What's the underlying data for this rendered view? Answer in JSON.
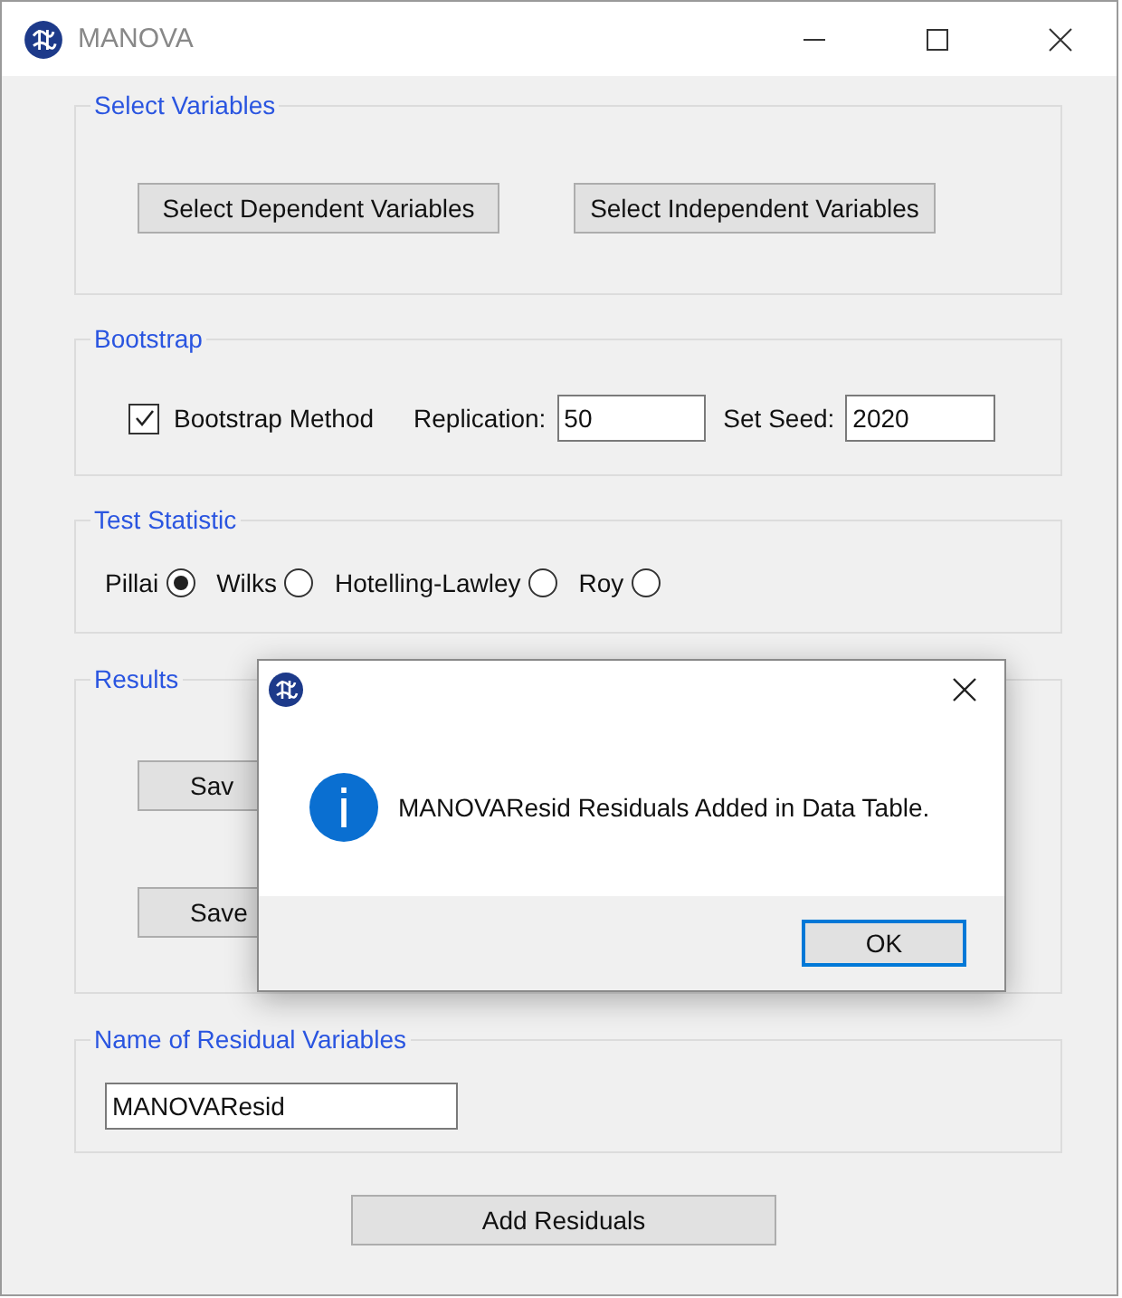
{
  "window": {
    "title": "MANOVA"
  },
  "select_variables": {
    "legend": "Select Variables",
    "buttons": [
      "Select Dependent Variables",
      "Select Independent Variables"
    ]
  },
  "bootstrap": {
    "legend": "Bootstrap",
    "checkbox": {
      "label": "Bootstrap Method",
      "checked": true
    },
    "replication": {
      "label": "Replication:",
      "value": "50"
    },
    "seed": {
      "label": "Set Seed:",
      "value": "2020"
    }
  },
  "test_statistic": {
    "legend": "Test Statistic",
    "options": [
      {
        "label": "Pillai",
        "selected": true
      },
      {
        "label": "Wilks",
        "selected": false
      },
      {
        "label": "Hotelling-Lawley",
        "selected": false
      },
      {
        "label": "Roy",
        "selected": false
      }
    ]
  },
  "results": {
    "legend": "Results",
    "buttons": [
      "Sav",
      "Save"
    ]
  },
  "residual_name": {
    "legend": "Name of Residual Variables",
    "value": "MANOVAResid"
  },
  "add_button": "Add Residuals",
  "dialog": {
    "message": "MANOVAResid Residuals Added in Data Table.",
    "button": "OK"
  }
}
